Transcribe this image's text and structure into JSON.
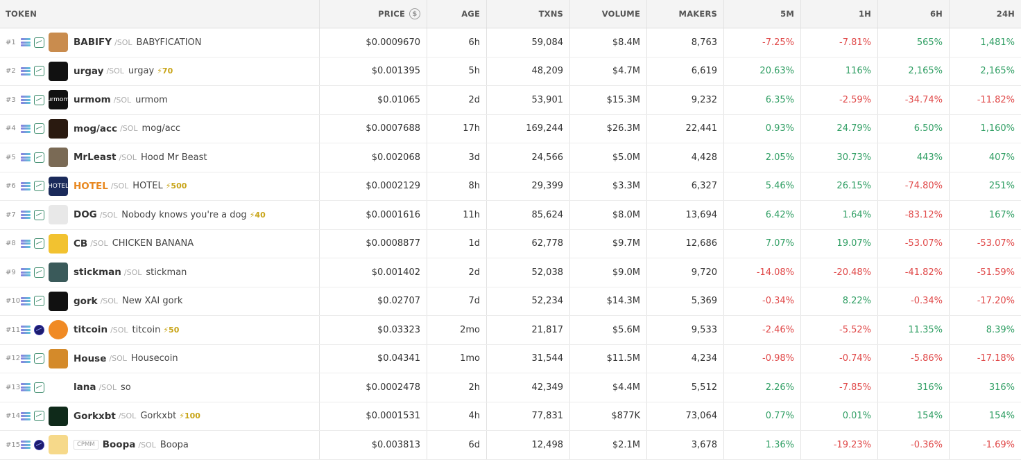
{
  "header": {
    "token": "TOKEN",
    "price": "PRICE",
    "age": "AGE",
    "txns": "TXNS",
    "volume": "VOLUME",
    "makers": "MAKERS",
    "m5": "5M",
    "h1": "1H",
    "h6": "6H",
    "h24": "24H"
  },
  "colors": {
    "positive": "#2f9e63",
    "negative": "#e04848",
    "boost": "#c8a417",
    "highlight_symbol": "#e8871e"
  },
  "rows": [
    {
      "rank": "#1",
      "symbol": "BABIFY",
      "quote": "/SOL",
      "name": "BABYFICATION",
      "boost": "",
      "cpmm": "",
      "avatar_text": "",
      "avatar_color": "#c98c4e",
      "dex": "solana",
      "price": "$0.0009670",
      "age": "6h",
      "txns": "59,084",
      "volume": "$8.4M",
      "makers": "8,763",
      "m5": "-7.25%",
      "h1": "-7.81%",
      "h6": "565%",
      "h24": "1,481%"
    },
    {
      "rank": "#2",
      "symbol": "urgay",
      "quote": "/SOL",
      "name": "urgay",
      "boost": "⚡70",
      "cpmm": "",
      "avatar_text": "",
      "avatar_color": "#111111",
      "dex": "solana",
      "price": "$0.001395",
      "age": "5h",
      "txns": "48,209",
      "volume": "$4.7M",
      "makers": "6,619",
      "m5": "20.63%",
      "h1": "116%",
      "h6": "2,165%",
      "h24": "2,165%"
    },
    {
      "rank": "#3",
      "symbol": "urmom",
      "quote": "/SOL",
      "name": "urmom",
      "boost": "",
      "cpmm": "",
      "avatar_text": "urmom",
      "avatar_color": "#111111",
      "dex": "solana",
      "price": "$0.01065",
      "age": "2d",
      "txns": "53,901",
      "volume": "$15.3M",
      "makers": "9,232",
      "m5": "6.35%",
      "h1": "-2.59%",
      "h6": "-34.74%",
      "h24": "-11.82%"
    },
    {
      "rank": "#4",
      "symbol": "mog/acc",
      "quote": "/SOL",
      "name": "mog/acc",
      "boost": "",
      "cpmm": "",
      "avatar_text": "",
      "avatar_color": "#2a1a10",
      "dex": "solana",
      "price": "$0.0007688",
      "age": "17h",
      "txns": "169,244",
      "volume": "$26.3M",
      "makers": "22,441",
      "m5": "0.93%",
      "h1": "24.79%",
      "h6": "6.50%",
      "h24": "1,160%"
    },
    {
      "rank": "#5",
      "symbol": "MrLeast",
      "quote": "/SOL",
      "name": "Hood Mr Beast",
      "boost": "",
      "cpmm": "",
      "avatar_text": "",
      "avatar_color": "#7a6a55",
      "dex": "solana",
      "price": "$0.002068",
      "age": "3d",
      "txns": "24,566",
      "volume": "$5.0M",
      "makers": "4,428",
      "m5": "2.05%",
      "h1": "30.73%",
      "h6": "443%",
      "h24": "407%"
    },
    {
      "rank": "#6",
      "symbol": "HOTEL",
      "quote": "/SOL",
      "name": "HOTEL",
      "boost": "⚡500",
      "cpmm": "",
      "avatar_text": "HOTEL",
      "avatar_color": "#1a2a5a",
      "dex": "solana",
      "price": "$0.0002129",
      "age": "8h",
      "txns": "29,399",
      "volume": "$3.3M",
      "makers": "6,327",
      "m5": "5.46%",
      "h1": "26.15%",
      "h6": "-74.80%",
      "h24": "251%"
    },
    {
      "rank": "#7",
      "symbol": "DOG",
      "quote": "/SOL",
      "name": "Nobody knows you're a dog",
      "boost": "⚡40",
      "cpmm": "",
      "avatar_text": "",
      "avatar_color": "#e8e8e8",
      "dex": "solana",
      "price": "$0.0001616",
      "age": "11h",
      "txns": "85,624",
      "volume": "$8.0M",
      "makers": "13,694",
      "m5": "6.42%",
      "h1": "1.64%",
      "h6": "-83.12%",
      "h24": "167%"
    },
    {
      "rank": "#8",
      "symbol": "CB",
      "quote": "/SOL",
      "name": "CHICKEN BANANA",
      "boost": "",
      "cpmm": "",
      "avatar_text": "",
      "avatar_color": "#f2c230",
      "dex": "solana",
      "price": "$0.0008877",
      "age": "1d",
      "txns": "62,778",
      "volume": "$9.7M",
      "makers": "12,686",
      "m5": "7.07%",
      "h1": "19.07%",
      "h6": "-53.07%",
      "h24": "-53.07%"
    },
    {
      "rank": "#9",
      "symbol": "stickman",
      "quote": "/SOL",
      "name": "stickman",
      "boost": "",
      "cpmm": "",
      "avatar_text": "",
      "avatar_color": "#3a5a5a",
      "dex": "solana",
      "price": "$0.001402",
      "age": "2d",
      "txns": "52,038",
      "volume": "$9.0M",
      "makers": "9,720",
      "m5": "-14.08%",
      "h1": "-20.48%",
      "h6": "-41.82%",
      "h24": "-51.59%"
    },
    {
      "rank": "#10",
      "symbol": "gork",
      "quote": "/SOL",
      "name": "New XAI gork",
      "boost": "",
      "cpmm": "",
      "avatar_text": "",
      "avatar_color": "#111111",
      "dex": "solana",
      "price": "$0.02707",
      "age": "7d",
      "txns": "52,234",
      "volume": "$14.3M",
      "makers": "5,369",
      "m5": "-0.34%",
      "h1": "8.22%",
      "h6": "-0.34%",
      "h24": "-17.20%"
    },
    {
      "rank": "#11",
      "symbol": "titcoin",
      "quote": "/SOL",
      "name": "titcoin",
      "boost": "⚡50",
      "cpmm": "",
      "avatar_text": "",
      "avatar_color": "#f08a24",
      "dex": "alt",
      "price": "$0.03323",
      "age": "2mo",
      "txns": "21,817",
      "volume": "$5.6M",
      "makers": "9,533",
      "m5": "-2.46%",
      "h1": "-5.52%",
      "h6": "11.35%",
      "h24": "8.39%"
    },
    {
      "rank": "#12",
      "symbol": "House",
      "quote": "/SOL",
      "name": "Housecoin",
      "boost": "",
      "cpmm": "",
      "avatar_text": "",
      "avatar_color": "#d48a2a",
      "dex": "solana",
      "price": "$0.04341",
      "age": "1mo",
      "txns": "31,544",
      "volume": "$11.5M",
      "makers": "4,234",
      "m5": "-0.98%",
      "h1": "-0.74%",
      "h6": "-5.86%",
      "h24": "-17.18%"
    },
    {
      "rank": "#13",
      "symbol": "lana",
      "quote": "/SOL",
      "name": "so",
      "boost": "",
      "cpmm": "",
      "avatar_text": "",
      "avatar_color": "#ffffff",
      "dex": "solana",
      "price": "$0.0002478",
      "age": "2h",
      "txns": "42,349",
      "volume": "$4.4M",
      "makers": "5,512",
      "m5": "2.26%",
      "h1": "-7.85%",
      "h6": "316%",
      "h24": "316%"
    },
    {
      "rank": "#14",
      "symbol": "Gorkxbt",
      "quote": "/SOL",
      "name": "Gorkxbt",
      "boost": "⚡100",
      "cpmm": "",
      "avatar_text": "",
      "avatar_color": "#0f2a1a",
      "dex": "solana",
      "price": "$0.0001531",
      "age": "4h",
      "txns": "77,831",
      "volume": "$877K",
      "makers": "73,064",
      "m5": "0.77%",
      "h1": "0.01%",
      "h6": "154%",
      "h24": "154%"
    },
    {
      "rank": "#15",
      "symbol": "Boopa",
      "quote": "/SOL",
      "name": "Boopa",
      "boost": "",
      "cpmm": "CPMM",
      "avatar_text": "",
      "avatar_color": "#f6d98a",
      "dex": "alt",
      "price": "$0.003813",
      "age": "6d",
      "txns": "12,498",
      "volume": "$2.1M",
      "makers": "3,678",
      "m5": "1.36%",
      "h1": "-19.23%",
      "h6": "-0.36%",
      "h24": "-1.69%"
    }
  ]
}
